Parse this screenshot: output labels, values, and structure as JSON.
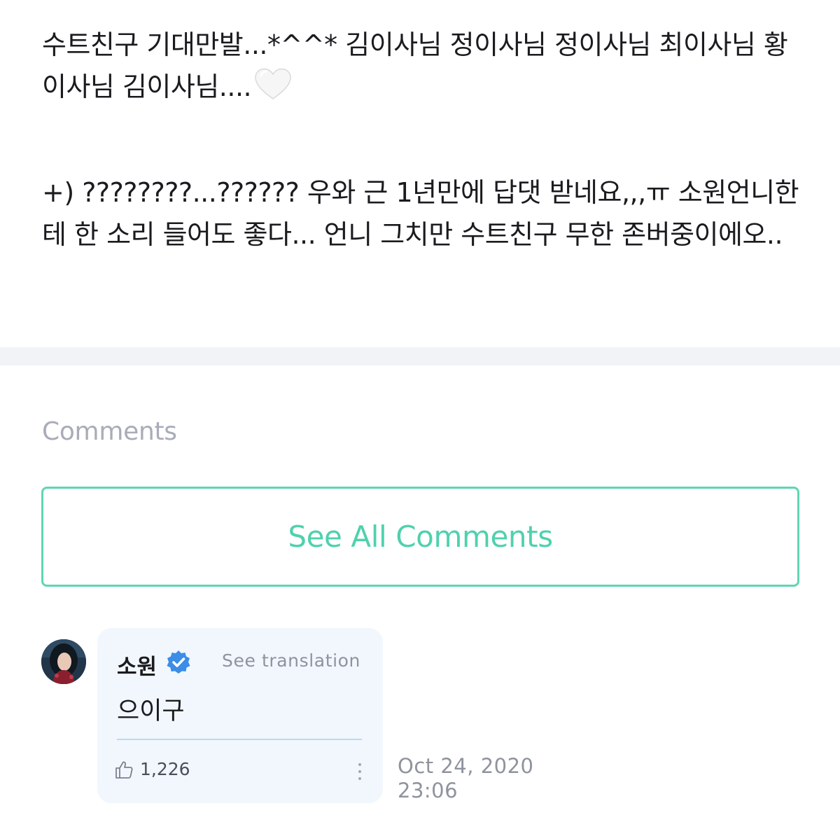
{
  "post": {
    "paragraph1": "수트친구 기대만발...*^^* 김이사님 정이사님 정이사님 최이사님 황이사님 김이사님....",
    "paragraph1_emoji": "white-heart",
    "paragraph2": "+) ????????...?????? 우와 근 1년만에 답댓 받네요,,,ㅠ 소원언니한테 한 소리 들어도 좋다... 언니 그치만 수트친구 무한 존버중이에오.."
  },
  "comments": {
    "header": "Comments",
    "see_all_label": "See All Comments",
    "items": [
      {
        "author": "소원",
        "verified": true,
        "see_translation_label": "See translation",
        "text": "으이구",
        "likes": "1,226",
        "date": "Oct 24, 2020",
        "time": "23:06"
      }
    ]
  },
  "colors": {
    "accent": "#4fd1ad",
    "accent_border": "#5fd6b4",
    "verified_blue": "#3b8de8",
    "bubble_bg": "#f1f7fd",
    "muted_text": "#8f939d",
    "divider": "#f2f3f7"
  }
}
